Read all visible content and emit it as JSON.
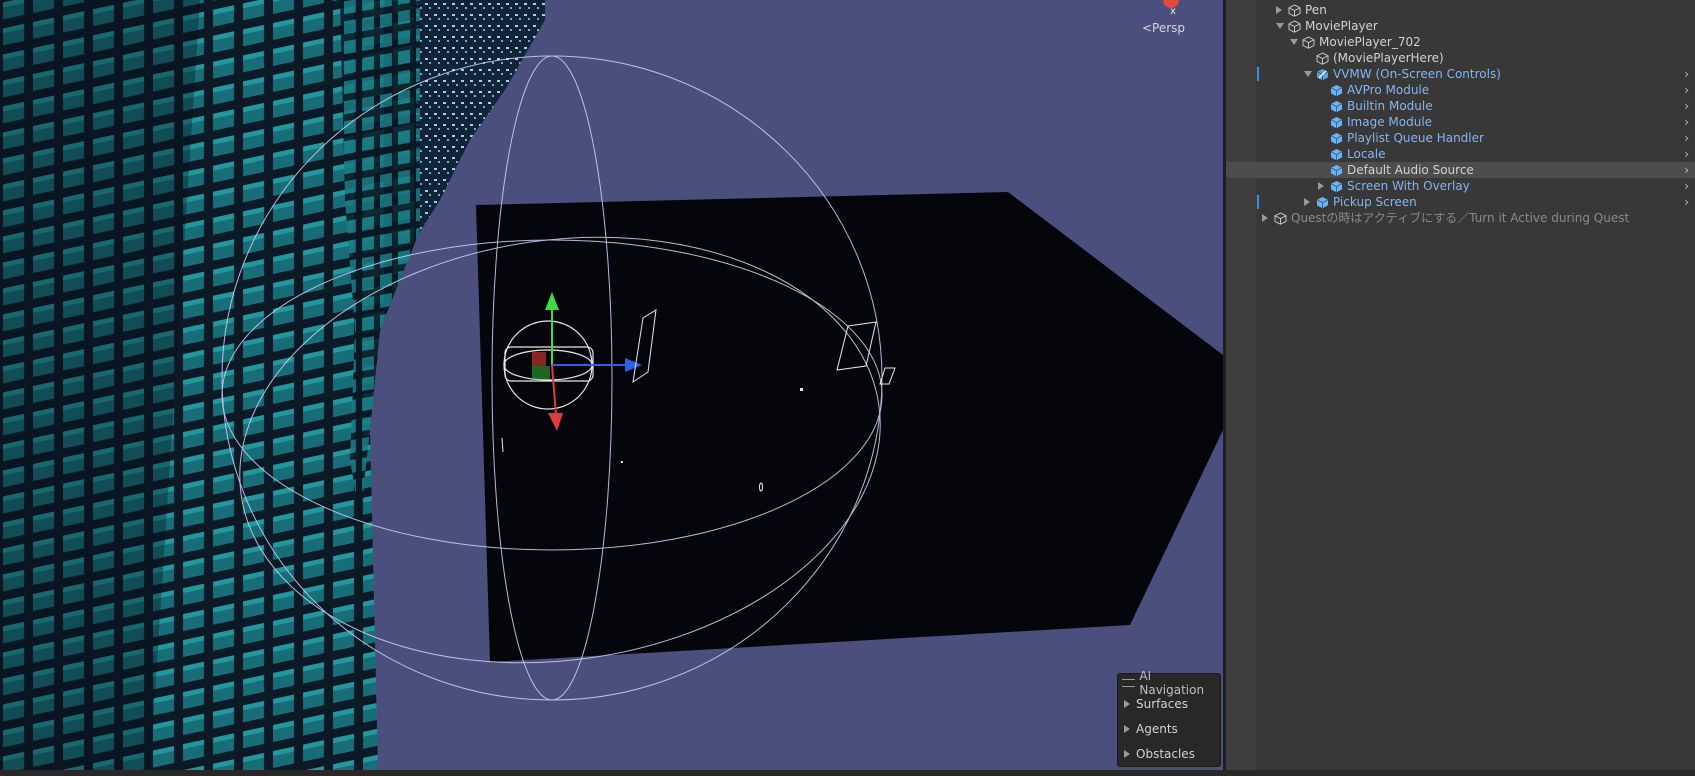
{
  "scene_view": {
    "persp_label": "<Persp",
    "axis_label": "x",
    "ai_navigation": {
      "title": "AI Navigation",
      "items": [
        "Surfaces",
        "Agents",
        "Obstacles"
      ]
    }
  },
  "hierarchy": {
    "rows": [
      {
        "label": "Pen",
        "fold": "collapsed",
        "icon": "cube-outline-icon",
        "style": "normal"
      },
      {
        "label": "MoviePlayer",
        "fold": "expanded",
        "icon": "cube-outline-icon",
        "style": "normal"
      },
      {
        "label": "MoviePlayer_702",
        "fold": "expanded",
        "icon": "cube-outline-icon",
        "style": "normal"
      },
      {
        "label": "(MoviePlayerHere)",
        "fold": "none",
        "icon": "cube-outline-icon",
        "style": "normal"
      },
      {
        "label": "VVMW (On-Screen Controls)",
        "fold": "expanded",
        "icon": "prefab-variant-icon",
        "style": "prefab"
      },
      {
        "label": "AVPro Module",
        "fold": "none",
        "icon": "prefab-icon",
        "style": "prefab"
      },
      {
        "label": "Builtin Module",
        "fold": "none",
        "icon": "prefab-icon",
        "style": "prefab"
      },
      {
        "label": "Image Module",
        "fold": "none",
        "icon": "prefab-icon",
        "style": "prefab"
      },
      {
        "label": "Playlist Queue Handler",
        "fold": "none",
        "icon": "prefab-icon",
        "style": "prefab"
      },
      {
        "label": "Locale",
        "fold": "none",
        "icon": "prefab-icon",
        "style": "prefab"
      },
      {
        "label": "Default Audio Source",
        "fold": "none",
        "icon": "prefab-icon",
        "style": "selected"
      },
      {
        "label": "Screen With Overlay",
        "fold": "collapsed",
        "icon": "prefab-icon",
        "style": "prefab"
      },
      {
        "label": "Pickup Screen",
        "fold": "collapsed",
        "icon": "prefab-icon",
        "style": "prefab"
      },
      {
        "label": "Questの時はアクティブにする／Turn it Active during Quest",
        "fold": "collapsed",
        "icon": "cube-outline-icon",
        "style": "inactive"
      }
    ]
  },
  "colors": {
    "sky": "#4a4f7e",
    "building": "#0d1d2a",
    "window_teal": "#1f8f95",
    "screen_black": "#04060c",
    "gizmo_x": "#e23b3b",
    "gizmo_y": "#3fdc3f",
    "gizmo_z": "#2f5df0",
    "prefab_blue": "#7fb7f5",
    "selection": "#4d4d4d"
  }
}
